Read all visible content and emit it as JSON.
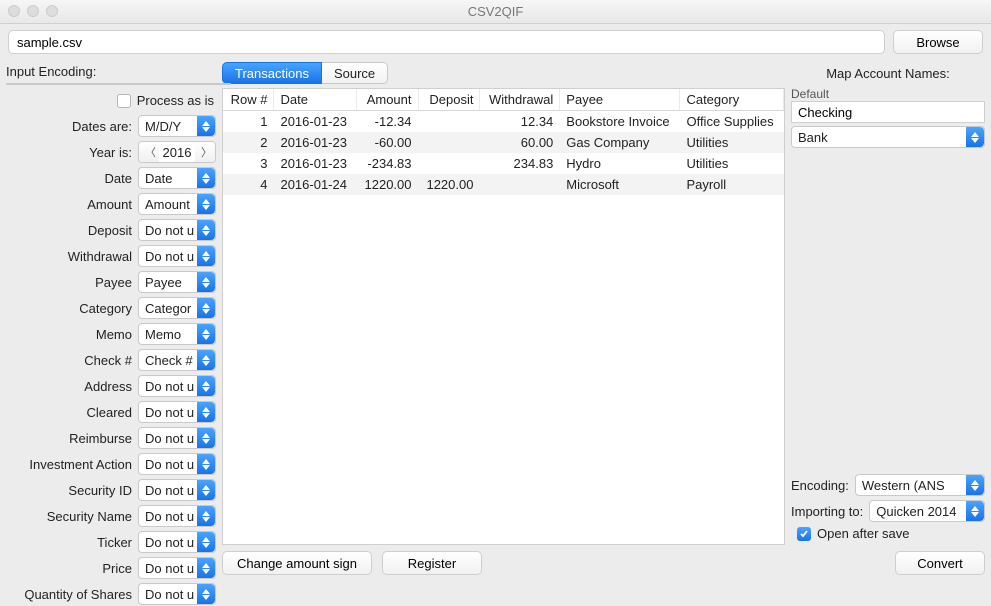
{
  "window": {
    "title": "CSV2QIF"
  },
  "file": {
    "path": "sample.csv",
    "browse": "Browse"
  },
  "leftPane": {
    "inputEncodingLabel": "Input Encoding:",
    "inputEncodingValue": "",
    "processAsIsLabel": "Process as is",
    "processAsIsChecked": false,
    "datesAreLabel": "Dates are:",
    "datesAreValue": "M/D/Y",
    "yearIsLabel": "Year is:",
    "yearIsValue": "2016",
    "fields": [
      {
        "label": "Date",
        "value": "Date"
      },
      {
        "label": "Amount",
        "value": "Amount"
      },
      {
        "label": "Deposit",
        "value": "Do not u"
      },
      {
        "label": "Withdrawal",
        "value": "Do not u"
      },
      {
        "label": "Payee",
        "value": "Payee"
      },
      {
        "label": "Category",
        "value": "Categor"
      },
      {
        "label": "Memo",
        "value": "Memo"
      },
      {
        "label": "Check #",
        "value": "Check #"
      },
      {
        "label": "Address",
        "value": "Do not u"
      },
      {
        "label": "Cleared",
        "value": "Do not u"
      },
      {
        "label": "Reimburse",
        "value": "Do not u"
      },
      {
        "label": "Investment Action",
        "value": "Do not u"
      },
      {
        "label": "Security ID",
        "value": "Do not u"
      },
      {
        "label": "Security Name",
        "value": "Do not u"
      },
      {
        "label": "Ticker",
        "value": "Do not u"
      },
      {
        "label": "Price",
        "value": "Do not u"
      },
      {
        "label": "Quantity of Shares",
        "value": "Do not u"
      }
    ]
  },
  "tabs": {
    "transactions": "Transactions",
    "source": "Source",
    "active": "transactions"
  },
  "table": {
    "headers": [
      "Row #",
      "Date",
      "Amount",
      "Deposit",
      "Withdrawal",
      "Payee",
      "Category"
    ],
    "rows": [
      {
        "row": "1",
        "date": "2016-01-23",
        "amount": "-12.34",
        "deposit": "",
        "withdrawal": "12.34",
        "payee": "Bookstore Invoice",
        "category": "Office Supplies"
      },
      {
        "row": "2",
        "date": "2016-01-23",
        "amount": "-60.00",
        "deposit": "",
        "withdrawal": "60.00",
        "payee": "Gas Company",
        "category": "Utilities"
      },
      {
        "row": "3",
        "date": "2016-01-23",
        "amount": "-234.83",
        "deposit": "",
        "withdrawal": "234.83",
        "payee": "Hydro",
        "category": "Utilities"
      },
      {
        "row": "4",
        "date": "2016-01-24",
        "amount": "1220.00",
        "deposit": "1220.00",
        "withdrawal": "",
        "payee": "Microsoft",
        "category": "Payroll"
      }
    ]
  },
  "bottomButtons": {
    "changeSign": "Change amount sign",
    "register": "Register"
  },
  "rightPane": {
    "title": "Map Account Names:",
    "defaultLabel": "Default",
    "defaultValue": "Checking",
    "accountTypeValue": "Bank",
    "encodingLabel": "Encoding:",
    "encodingValue": "Western (ANS",
    "importingLabel": "Importing to:",
    "importingValue": "Quicken 2014",
    "openAfterSaveLabel": "Open after save",
    "openAfterSaveChecked": true,
    "convert": "Convert"
  }
}
